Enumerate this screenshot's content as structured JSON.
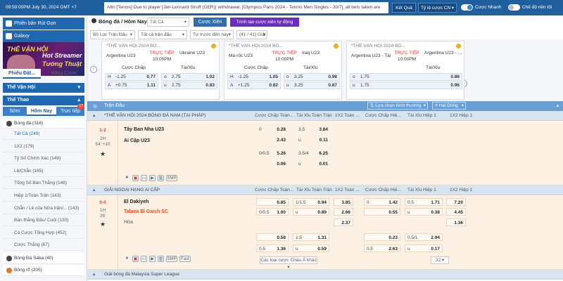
{
  "topbar": {
    "clock": "09:59:00PM July 30, 2024 GMT +7",
    "ticker": "Attn:[Tennis] Due to player [Jan-Lennard Struff (GER)] withdrawal, [Olympics Paris 2024 - Tennis Men Singles - 30/7], all bets taken are",
    "result_btn": "Kết Quả",
    "odds_type": "Tỷ lệ cược CN",
    "toggle1": "Cược Nhanh",
    "toggle2": "Chế độ nền tối",
    "accent": "#1f5f9e"
  },
  "sidebar": {
    "promo1": "Phiên bản Rút Gọn",
    "promo2": "Galaxy",
    "banner": {
      "l1": "THỂ VẬN HỘI",
      "l2": "Hot Streamer",
      "l3": "Tướng Thuật"
    },
    "tab1": "Phiếu Đặt...",
    "tab2": "Bảng Cược",
    "sec1": "Thế Vận Hội",
    "sec2": "Thể Thao",
    "sub1": "Sớm",
    "sub2": "Hôm Nay",
    "sub3": "Trực tiếp",
    "sub3_badge": "17",
    "sport": "Bóng đá",
    "sport_count": "(316)",
    "items": [
      {
        "label": "Tất Cả",
        "count": "(249)"
      },
      {
        "label": "1X2",
        "count": "(179)"
      },
      {
        "label": "Tỷ Số Chính Xác",
        "count": "(149)"
      },
      {
        "label": "Lẻ/Chẵn",
        "count": "(165)"
      },
      {
        "label": "Tổng Số Bàn Thắng",
        "count": "(148)"
      },
      {
        "label": "Hiệp 1/Toàn Trận",
        "count": "(143)"
      },
      {
        "label": "Chẵn / Lẻ của Nửa trận/...",
        "count": "(143)"
      },
      {
        "label": "Bàn thắng Đầu/ Cuối",
        "count": "(120)"
      },
      {
        "label": "Cá Cược Tổng Hợp",
        "count": "(452)"
      },
      {
        "label": "Cược Thắng",
        "count": "(67)"
      }
    ],
    "sports": [
      {
        "label": "Bóng Đá Saba",
        "count": "(40)"
      },
      {
        "label": "Bóng rổ",
        "count": "(205)"
      }
    ]
  },
  "main": {
    "crumb": "Bóng đá / Hôm Nay",
    "crumb_sel": "Tất Cả",
    "btn_xien": "Cược Xiên",
    "btn_auto": "Trình tạo cược xiên tự động",
    "filters": [
      "Bộ Lọc Trận Đấu",
      "Tất cả trận đấu",
      "Tự trước đến nay",
      "(41 / 41) Giải"
    ],
    "cards": [
      {
        "league": "*THẾ VẬN HỘI 2024 BÓ...",
        "home": "Argentina U23",
        "away": "Ukraine U23",
        "status": "TRỰC TIẾP",
        "time": "10:00PM",
        "h1": "Cược Chấp",
        "h2": "Tài/Xỉu",
        "rows": [
          [
            "H",
            "-1.25",
            "0.77",
            "o",
            "2.75",
            "1.02"
          ],
          [
            "A",
            "+0.75",
            "1.11",
            "u",
            "2.75",
            "0.83"
          ]
        ]
      },
      {
        "league": "*THẾ VẬN HỘI 2024 BÓ...",
        "home": "Ma-rốc U23",
        "away": "Iraq U23",
        "status": "TRỰC TIẾP",
        "time": "10:00PM",
        "h1": "Cược Chấp",
        "h2": "Tài/Xỉu",
        "rows": [
          [
            "H",
            "-1.25",
            "1.05",
            "o",
            "3.25",
            "0.98"
          ],
          [
            "A",
            "+1.25",
            "0.82",
            "u",
            "3.25",
            "0.87"
          ]
        ]
      },
      {
        "league": "*THẾ VẬN HỘI 2024 BÓ...",
        "home": "Argentina U23 - Tài",
        "away": "Argentina U23 - Xỉu",
        "status": "TRỰC TIẾP",
        "time": "10:00PM",
        "h1": "",
        "h2": "Tài/Xỉu",
        "rows": [
          [
            "",
            "",
            "",
            "o",
            "1.75",
            "0.86"
          ],
          [
            "",
            "",
            "",
            "u",
            "1.75",
            "0.96"
          ]
        ]
      }
    ],
    "thead": {
      "label": "Trận Đấu",
      "sort": "Lựa chọn bình thường",
      "view": "Hai Dòng"
    },
    "cols": [
      "Cược Chấp Toàn...",
      "Tài Xỉu Toàn Trận",
      "1X2 Toàn ...",
      "Cược Chấp Hiệ...",
      "Tài Xỉu Hiệp 1",
      "1X2 Hiệp 1"
    ],
    "leagues": [
      "*THẾ VẬN HỘI 2024 BÓNG ĐÁ NAM (TẠI PHÁP)",
      "GIẢI NGOẠI HẠNG AI CẬP",
      "Giải bóng đá Malaysia Super League"
    ],
    "m1": {
      "score": "1-2",
      "period": "2H",
      "clock": "54' +10",
      "home": "Tây Ban Nha U23",
      "away": "Ai Cập U23",
      "hdp": [
        [
          "0",
          "0.28"
        ],
        [
          "",
          "2.43"
        ],
        [
          "0/0.5",
          "5.26"
        ],
        [
          "",
          "0.06"
        ]
      ],
      "ou": [
        [
          "3.5",
          "3.84"
        ],
        [
          "u",
          "0.11"
        ],
        [
          "3.5/4",
          "6.25"
        ],
        [
          "u",
          "0.01"
        ]
      ]
    },
    "m2": {
      "score": "0-0",
      "period": "1H",
      "clock": "26'",
      "home": "El Dakiyeh",
      "away": "Talaea El Gaish SC",
      "draw": "Hòa",
      "hdp": [
        [
          "",
          "0.85"
        ],
        [
          "0/0.5",
          "1.00"
        ],
        [
          "",
          "0.58"
        ],
        [
          "0.5",
          "1.36"
        ]
      ],
      "ou": [
        [
          "1/1.5",
          "0.94"
        ],
        [
          "u",
          "0.89"
        ],
        [
          "1.5",
          "1.31"
        ],
        [
          "u",
          "0.59"
        ]
      ],
      "x12": [
        "3.85",
        "2.66",
        "2.37"
      ],
      "h1hdp": [
        [
          "0",
          "1.42"
        ],
        [
          "",
          "0.55"
        ],
        [
          "",
          "0.23"
        ],
        [
          "0.5",
          "2.63"
        ]
      ],
      "h1ou": [
        [
          "0.5",
          "1.71"
        ],
        [
          "u",
          "0.38"
        ],
        [
          "0.5/1",
          "2.94"
        ],
        [
          "u",
          "0.17"
        ]
      ],
      "h1x12": [
        "7.20",
        "4.45",
        "1.36"
      ],
      "more": "Các loại cược Châu Á khác",
      "count": "32"
    },
    "icon_smp": "SMP",
    "icon_fast": "Fast"
  }
}
